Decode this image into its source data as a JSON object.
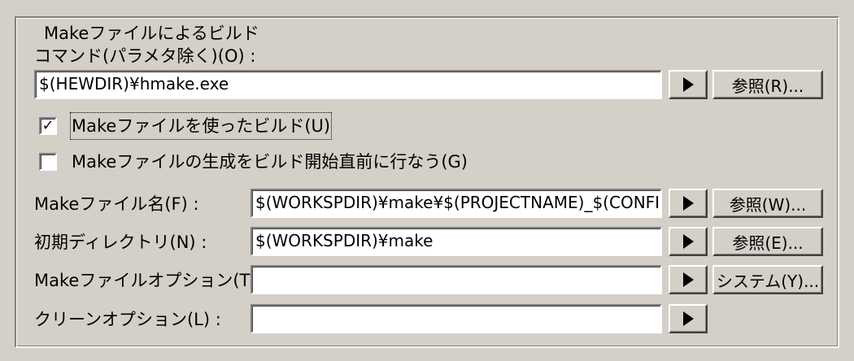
{
  "group_title": "Makeファイルによるビルド",
  "command": {
    "label": "コマンド(パラメタ除く)(O) :",
    "value": "$(HEWDIR)¥hmake.exe",
    "browse_label": "参照(R)..."
  },
  "use_makefile": {
    "label": "Makeファイルを使ったビルド(U)",
    "checked": true,
    "mark": "✓"
  },
  "generate_makefile": {
    "label": "Makeファイルの生成をビルド開始直前に行なう(G)",
    "checked": false,
    "mark": ""
  },
  "makefile_name": {
    "label": "Makeファイル名(F) :",
    "value": "$(WORKSPDIR)¥make¥$(PROJECTNAME)_$(CONFIGNAME).mak",
    "browse_label": "参照(W)..."
  },
  "initial_dir": {
    "label": "初期ディレクトリ(N) :",
    "value": "$(WORKSPDIR)¥make",
    "browse_label": "参照(E)..."
  },
  "make_options": {
    "label": "Makeファイルオプション(T) :",
    "value": "",
    "system_label": "システム(Y)..."
  },
  "clean_options": {
    "label": "クリーンオプション(L) :",
    "value": ""
  },
  "icons": {
    "arrow": "play-arrow-icon",
    "check": "checkmark-icon"
  }
}
